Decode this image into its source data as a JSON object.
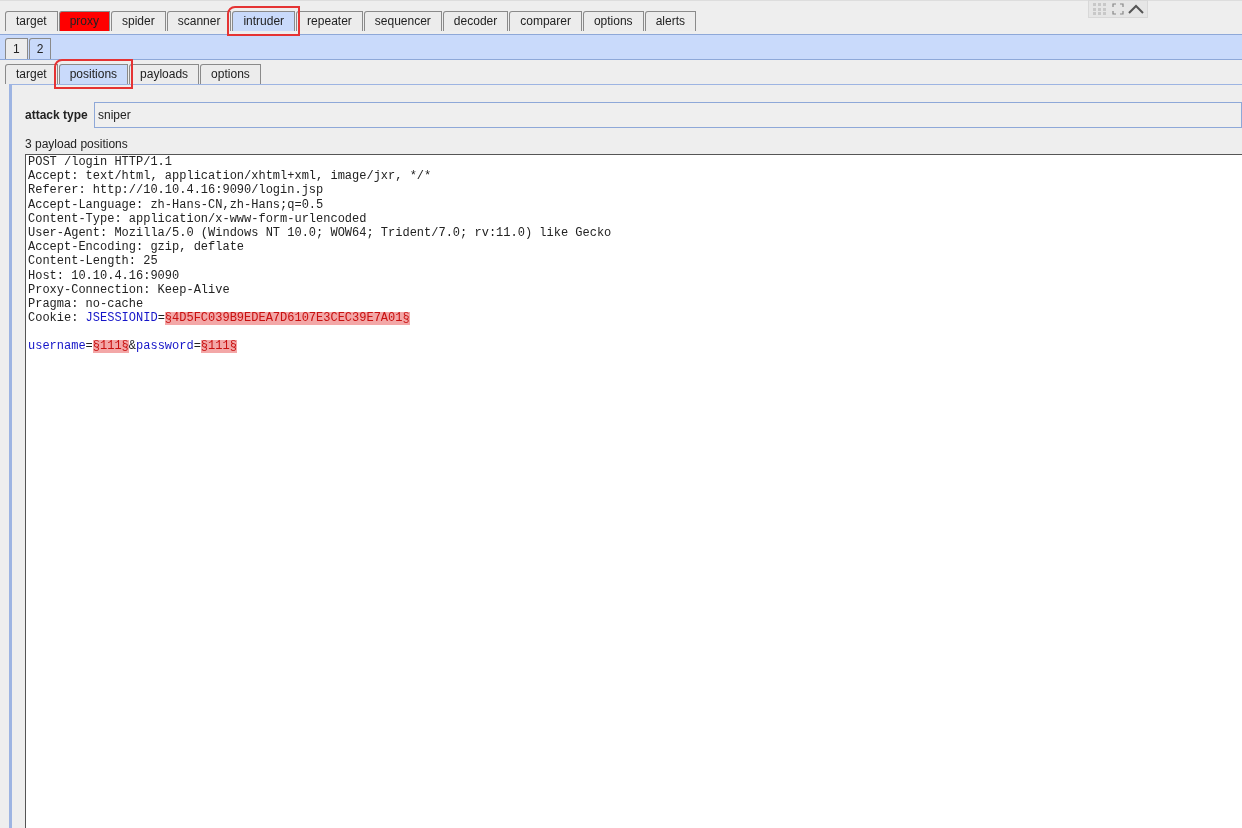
{
  "main_tabs": [
    {
      "label": "target",
      "selected": false,
      "alert": false,
      "annotated": false
    },
    {
      "label": "proxy",
      "selected": false,
      "alert": true,
      "annotated": false
    },
    {
      "label": "spider",
      "selected": false,
      "alert": false,
      "annotated": false
    },
    {
      "label": "scanner",
      "selected": false,
      "alert": false,
      "annotated": false
    },
    {
      "label": "intruder",
      "selected": true,
      "alert": false,
      "annotated": true
    },
    {
      "label": "repeater",
      "selected": false,
      "alert": false,
      "annotated": false
    },
    {
      "label": "sequencer",
      "selected": false,
      "alert": false,
      "annotated": false
    },
    {
      "label": "decoder",
      "selected": false,
      "alert": false,
      "annotated": false
    },
    {
      "label": "comparer",
      "selected": false,
      "alert": false,
      "annotated": false
    },
    {
      "label": "options",
      "selected": false,
      "alert": false,
      "annotated": false
    },
    {
      "label": "alerts",
      "selected": false,
      "alert": false,
      "annotated": false
    }
  ],
  "attack_tabs": [
    {
      "label": "1",
      "selected": false
    },
    {
      "label": "2",
      "selected": true
    }
  ],
  "sub_tabs": [
    {
      "label": "target",
      "selected": false,
      "annotated": false
    },
    {
      "label": "positions",
      "selected": true,
      "annotated": true
    },
    {
      "label": "payloads",
      "selected": false,
      "annotated": false
    },
    {
      "label": "options",
      "selected": false,
      "annotated": false
    }
  ],
  "attack_type": {
    "label": "attack type",
    "value": "sniper"
  },
  "positions_count": "3 payload positions",
  "request_lines": [
    {
      "kind": "text",
      "segments": [
        {
          "kind": "plain",
          "text": "POST /login HTTP/1.1"
        }
      ]
    },
    {
      "kind": "text",
      "segments": [
        {
          "kind": "plain",
          "text": "Accept: text/html, application/xhtml+xml, image/jxr, */*"
        }
      ]
    },
    {
      "kind": "text",
      "segments": [
        {
          "kind": "plain",
          "text": "Referer: http://10.10.4.16:9090/login.jsp"
        }
      ]
    },
    {
      "kind": "text",
      "segments": [
        {
          "kind": "plain",
          "text": "Accept-Language: zh-Hans-CN,zh-Hans;q=0.5"
        }
      ]
    },
    {
      "kind": "text",
      "segments": [
        {
          "kind": "plain",
          "text": "Content-Type: application/x-www-form-urlencoded"
        }
      ]
    },
    {
      "kind": "text",
      "segments": [
        {
          "kind": "plain",
          "text": "User-Agent: Mozilla/5.0 (Windows NT 10.0; WOW64; Trident/7.0; rv:11.0) like Gecko"
        }
      ]
    },
    {
      "kind": "text",
      "segments": [
        {
          "kind": "plain",
          "text": "Accept-Encoding: gzip, deflate"
        }
      ]
    },
    {
      "kind": "text",
      "segments": [
        {
          "kind": "plain",
          "text": "Content-Length: 25"
        }
      ]
    },
    {
      "kind": "text",
      "segments": [
        {
          "kind": "plain",
          "text": "Host: 10.10.4.16:9090"
        }
      ]
    },
    {
      "kind": "text",
      "segments": [
        {
          "kind": "plain",
          "text": "Proxy-Connection: Keep-Alive"
        }
      ]
    },
    {
      "kind": "text",
      "segments": [
        {
          "kind": "plain",
          "text": "Pragma: no-cache"
        }
      ]
    },
    {
      "kind": "text",
      "segments": [
        {
          "kind": "plain",
          "text": "Cookie: "
        },
        {
          "kind": "param",
          "text": "JSESSIONID"
        },
        {
          "kind": "plain",
          "text": "="
        },
        {
          "kind": "payload",
          "text": "§4D5FC039B9EDEA7D6107E3CEC39E7A01§"
        }
      ]
    },
    {
      "kind": "blank"
    },
    {
      "kind": "text",
      "segments": [
        {
          "kind": "param",
          "text": "username"
        },
        {
          "kind": "plain",
          "text": "="
        },
        {
          "kind": "payload",
          "text": "§111§"
        },
        {
          "kind": "plain",
          "text": "&"
        },
        {
          "kind": "param",
          "text": "password"
        },
        {
          "kind": "plain",
          "text": "="
        },
        {
          "kind": "payload",
          "text": "§111§"
        }
      ]
    }
  ]
}
